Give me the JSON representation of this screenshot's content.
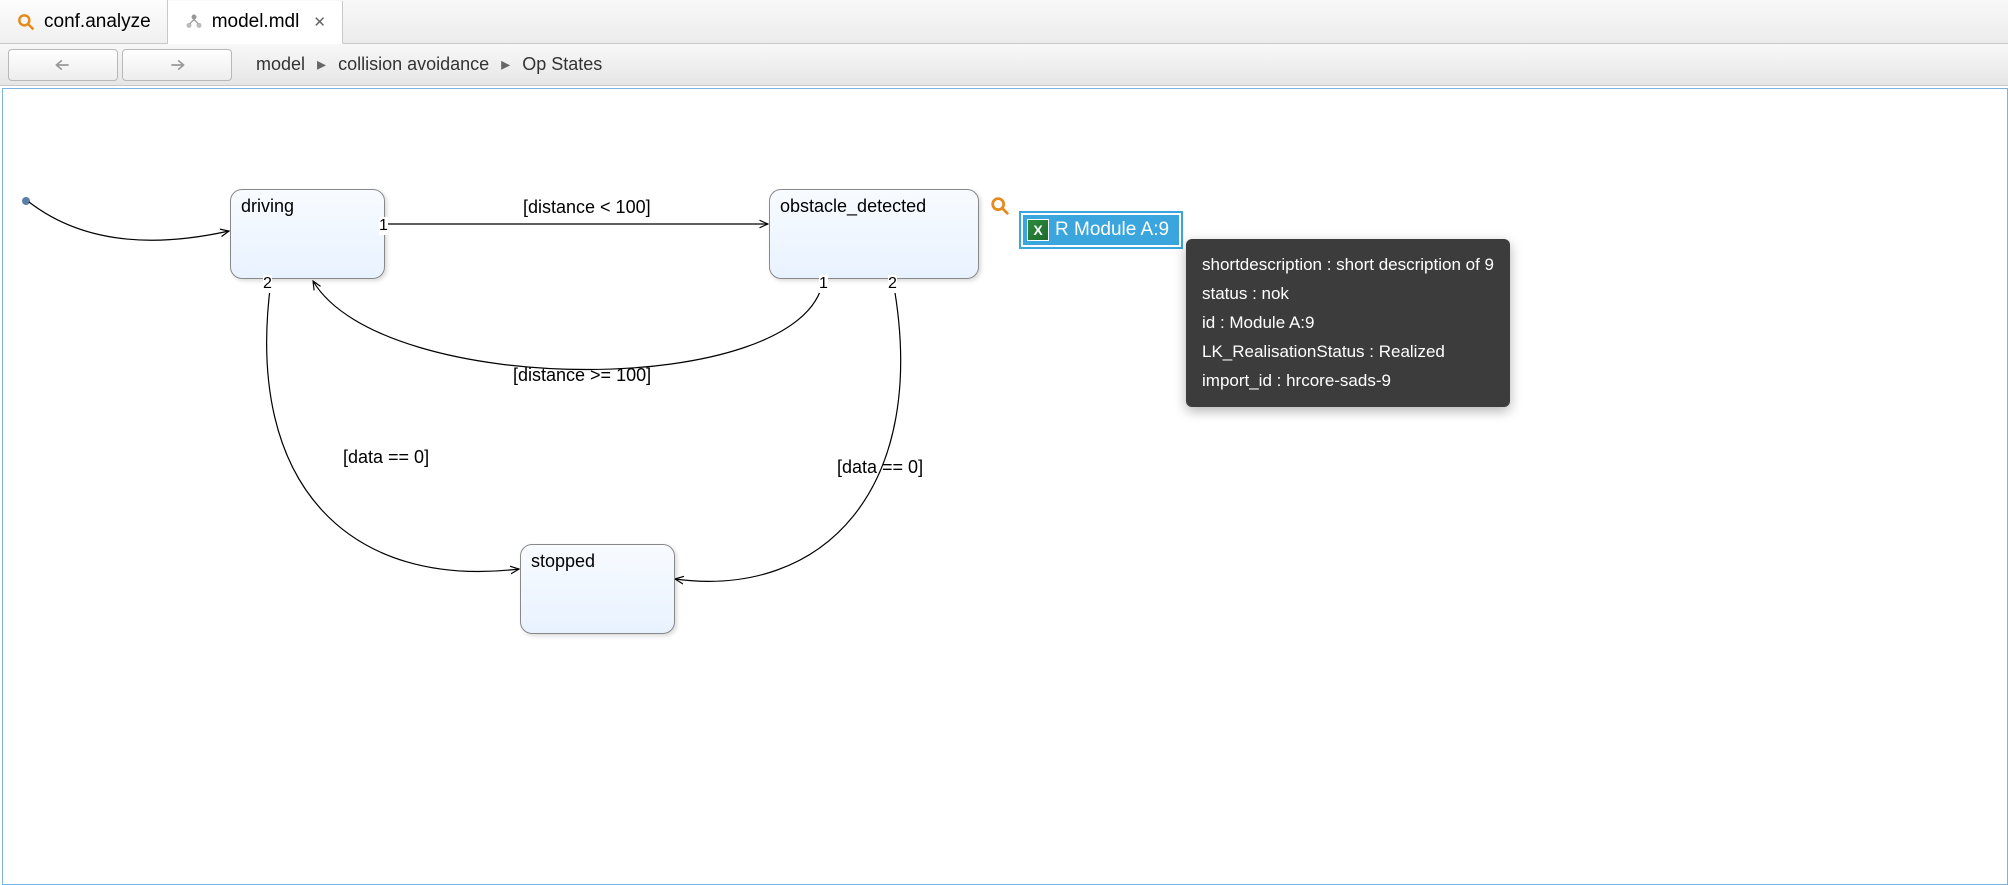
{
  "tabs": [
    {
      "label": "conf.analyze",
      "icon": "search-icon",
      "active": false
    },
    {
      "label": "model.mdl",
      "icon": "model-icon",
      "active": true,
      "closable": true
    }
  ],
  "breadcrumb": {
    "items": [
      "model",
      "collision avoidance",
      "Op States"
    ]
  },
  "states": {
    "driving": {
      "label": "driving"
    },
    "obstacle_detected": {
      "label": "obstacle_detected"
    },
    "stopped": {
      "label": "stopped"
    }
  },
  "transitions": {
    "t1": {
      "guard": "[distance < 100]"
    },
    "t2": {
      "guard": "[distance >= 100]"
    },
    "t3": {
      "guard": "[data == 0]"
    },
    "t4": {
      "guard": "[data == 0]"
    }
  },
  "ports": {
    "driving_right": "1",
    "driving_bottom_left": "2",
    "obstacle_bottom_left": "1",
    "obstacle_bottom_right": "2"
  },
  "annotation": {
    "label": "R Module A:9"
  },
  "tooltip": {
    "lines": [
      "shortdescription : short description of 9",
      "status : nok",
      "id : Module A:9",
      "LK_RealisationStatus : Realized",
      "import_id : hrcore-sads-9"
    ]
  }
}
